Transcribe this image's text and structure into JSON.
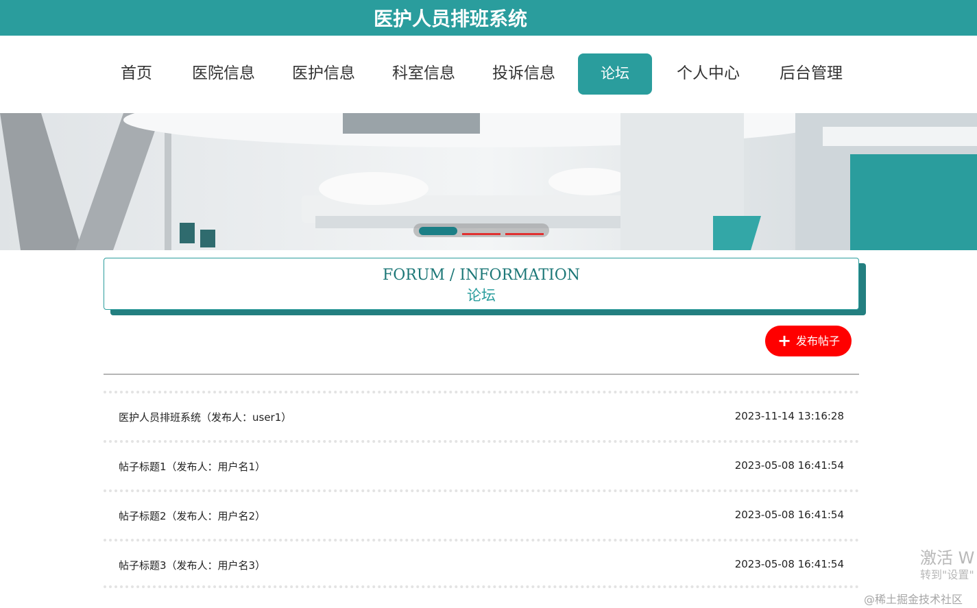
{
  "header": {
    "title": "医护人员排班系统"
  },
  "nav": {
    "items": [
      {
        "label": "首页"
      },
      {
        "label": "医院信息"
      },
      {
        "label": "医护信息"
      },
      {
        "label": "科室信息"
      },
      {
        "label": "投诉信息"
      },
      {
        "label": "论坛",
        "active": true
      },
      {
        "label": "个人中心"
      },
      {
        "label": "后台管理"
      }
    ]
  },
  "banner": {
    "slide_count": 3,
    "active_slide": 1
  },
  "section": {
    "title_en": "FORUM / INFORMATION",
    "title_cn": "论坛"
  },
  "actions": {
    "publish_label": "发布帖子",
    "publish_icon": "plus-icon"
  },
  "posts": [
    {
      "title": "医护人员排班系统（发布人：user1）",
      "time": "2023-11-14 13:16:28"
    },
    {
      "title": "帖子标题1（发布人：用户名1）",
      "time": "2023-05-08 16:41:54"
    },
    {
      "title": "帖子标题2（发布人：用户名2）",
      "time": "2023-05-08 16:41:54"
    },
    {
      "title": "帖子标题3（发布人：用户名3）",
      "time": "2023-05-08 16:41:54"
    }
  ],
  "watermark": {
    "line1": "激活 W",
    "line2": "转到\"设置\"",
    "credit": "@稀土掘金技术社区"
  },
  "colors": {
    "primary": "#2a9d9d",
    "danger": "#ff0000"
  }
}
